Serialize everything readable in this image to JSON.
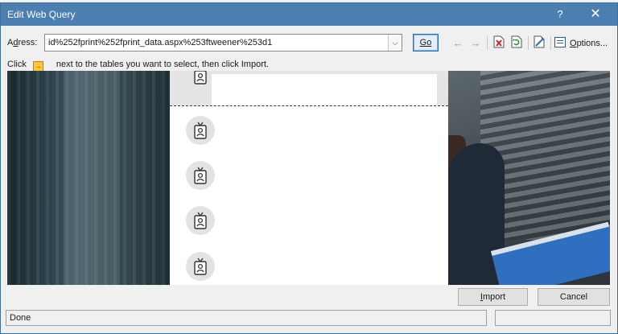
{
  "window": {
    "title": "Edit Web Query",
    "help_glyph": "?",
    "close_glyph": "✕"
  },
  "address": {
    "label_underlined": "d",
    "label_rest": "ress:",
    "label_first": "A",
    "value": "id%252fprint%252fprint_data.aspx%253ftweener%253d1",
    "dropdown_glyph": "⌵"
  },
  "toolbar": {
    "go_label": "Go",
    "back_glyph": "←",
    "forward_glyph": "→",
    "options_underlined": "O",
    "options_rest": "ptions..."
  },
  "instruction": {
    "before": "Click",
    "arrow_glyph": "→",
    "after": "next to the tables you want to select, then click Import."
  },
  "buttons": {
    "import_underlined": "I",
    "import_rest": "mport",
    "cancel_label": "Cancel"
  },
  "status": {
    "text": "Done"
  },
  "icons": {
    "stop": "stop-icon",
    "refresh": "refresh-icon",
    "save_query": "save-query-icon",
    "options": "options-icon",
    "badge": "id-badge-icon"
  },
  "colors": {
    "titlebar": "#4a7fb0",
    "go_button_border": "#2b6fb6",
    "table_arrow": "#ffc637"
  }
}
